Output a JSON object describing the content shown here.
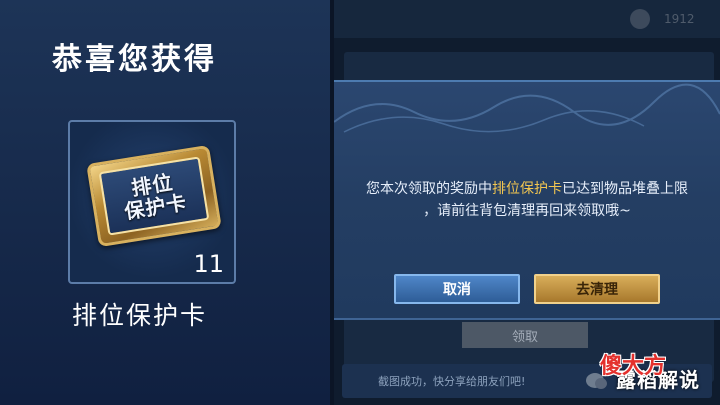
{
  "left": {
    "title": "恭喜您获得",
    "item": {
      "card_line1": "排位",
      "card_line2": "保护卡",
      "count": "11",
      "name": "排位保护卡"
    }
  },
  "top_bar": {
    "number": "1912"
  },
  "dialog": {
    "message_prefix": "您本次领取的奖励中",
    "message_highlight": "排位保护卡",
    "message_suffix": "已达到物品堆叠上限",
    "message_line2": "，请前往背包清理再回来领取哦~",
    "cancel_label": "取消",
    "clean_label": "去清理"
  },
  "behind": {
    "claim_label": "领取",
    "share_text": "截图成功，快分享给朋友们吧!",
    "share_icon": "wechat-icon",
    "overlay_text": "露稻解说"
  },
  "watermark": "傻大方",
  "colors": {
    "highlight": "#f2c650",
    "cancel": "#3f74b5",
    "clean": "#c49745"
  }
}
